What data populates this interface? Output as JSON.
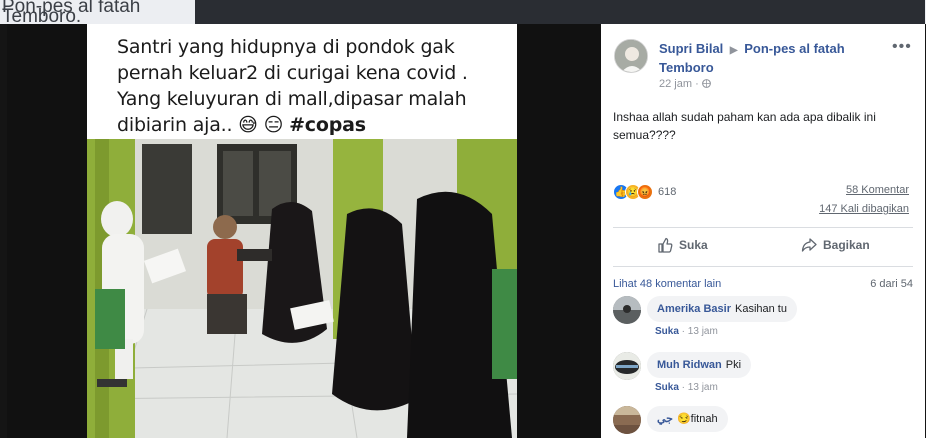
{
  "background": {
    "text_line1": "Pon-pes al fatah",
    "text_line2": "Temboro."
  },
  "photo": {
    "caption": "Santri yang hidupnya di pondok gak pernah keluar2 di curigai kena covid . Yang keluyuran di mall,dipasar malah dibiarin aja.. 😅 😑",
    "caption_hashtag": "#copas"
  },
  "post": {
    "author": "Supri Bilal",
    "group": "Pon-pes al fatah Temboro",
    "time": "22 jam",
    "text": "Inshaa allah sudah paham kan ada apa dibalik ini semua????",
    "reactions_count": "618",
    "comments_count": "58 Komentar",
    "shares_count": "147 Kali dibagikan",
    "like_label": "Suka",
    "share_label": "Bagikan",
    "more_comments": "Lihat 48 komentar lain",
    "paging": "6 dari 54"
  },
  "comments": [
    {
      "name": "Amerika Basir",
      "text": "Kasihan tu",
      "like": "Suka",
      "time": "13 jam"
    },
    {
      "name": "Muh Ridwan",
      "text": "Pki",
      "like": "Suka",
      "time": "13 jam"
    },
    {
      "name": "جي",
      "text": "😏fitnah",
      "like": "",
      "time": ""
    }
  ],
  "colors": {
    "link": "#385898",
    "like_blue": "#1877f2"
  }
}
